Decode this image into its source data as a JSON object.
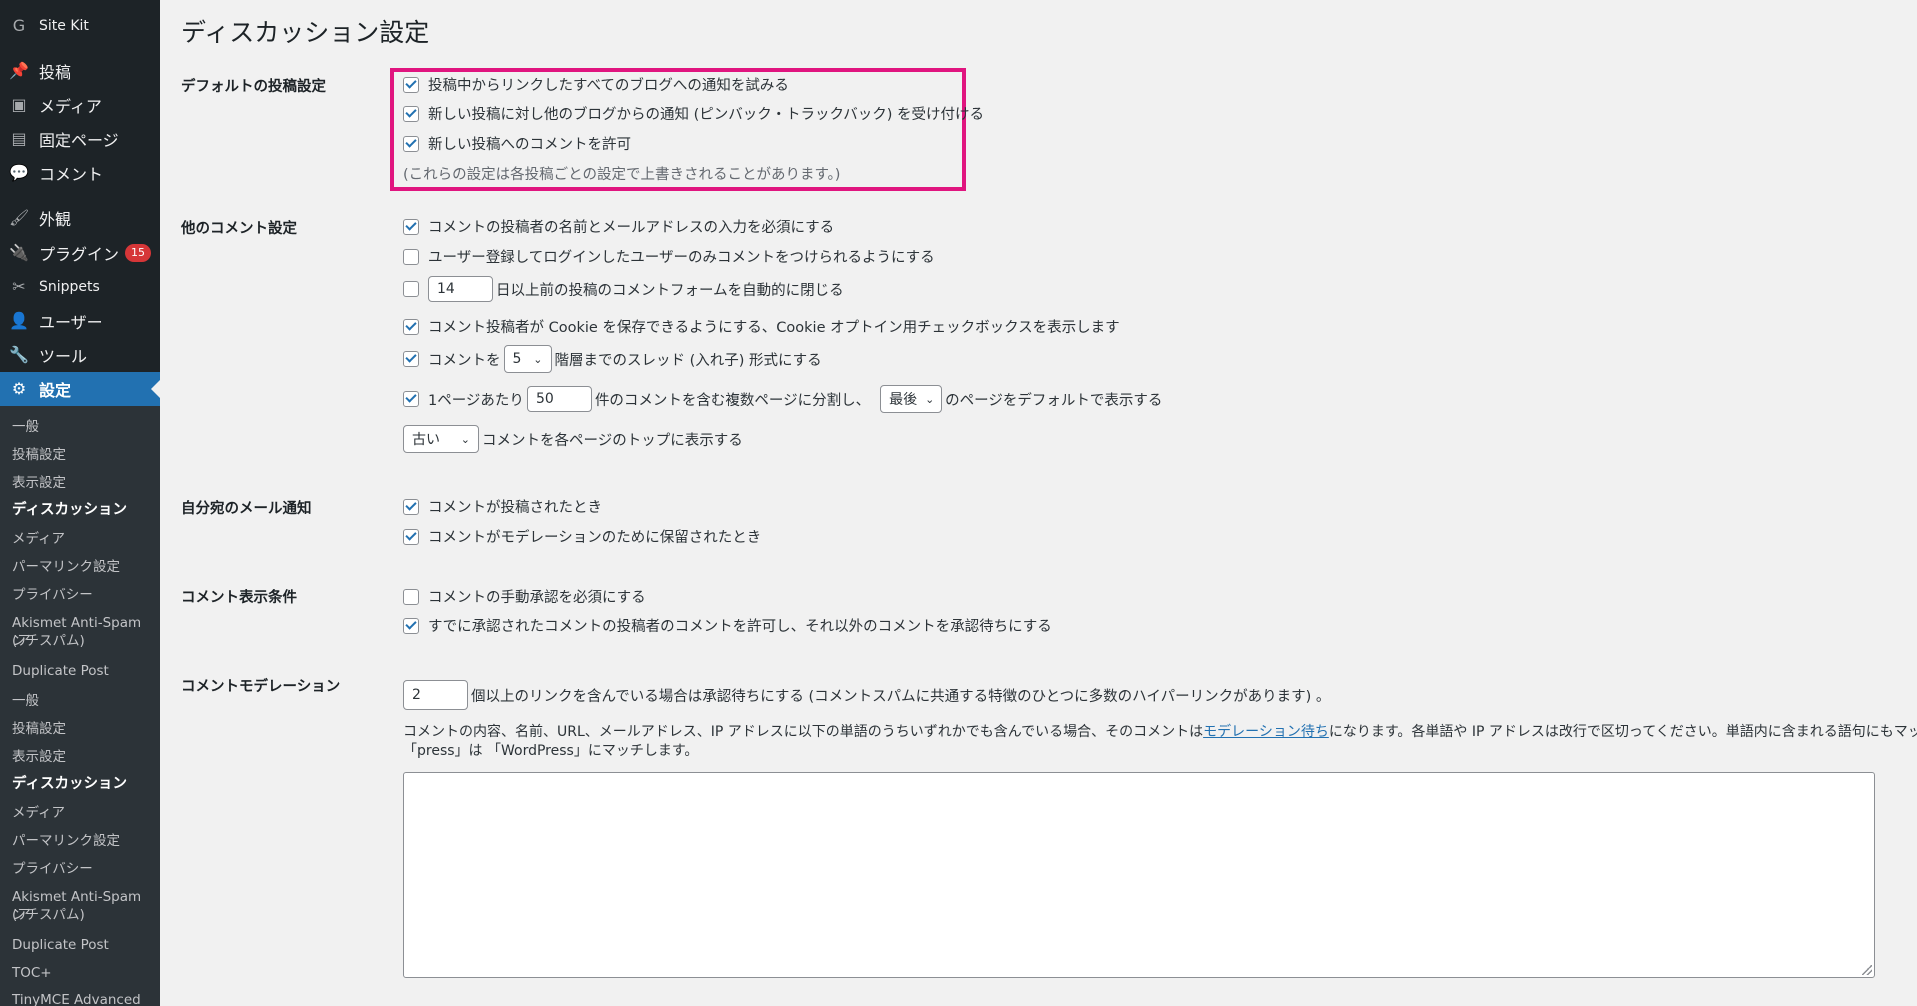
{
  "sidebar": {
    "menu": [
      {
        "icon": "G",
        "icon_name": "google-g-icon",
        "label": "Site Kit"
      },
      {
        "icon": "📌",
        "icon_name": "pin-icon",
        "label": "投稿"
      },
      {
        "icon": "▣",
        "icon_name": "media-icon",
        "label": "メディア"
      },
      {
        "icon": "▤",
        "icon_name": "page-icon",
        "label": "固定ページ"
      },
      {
        "icon": "💬",
        "icon_name": "comment-icon",
        "label": "コメント"
      },
      {
        "icon": "🖌",
        "icon_name": "brush-icon",
        "label": "外観"
      },
      {
        "icon": "🔌",
        "icon_name": "plugin-icon",
        "label": "プラグイン",
        "badge": "15"
      },
      {
        "icon": "✂",
        "icon_name": "scissors-icon",
        "label": "Snippets"
      },
      {
        "icon": "👤",
        "icon_name": "user-icon",
        "label": "ユーザー"
      },
      {
        "icon": "🔧",
        "icon_name": "wrench-icon",
        "label": "ツール"
      },
      {
        "icon": "⚙",
        "icon_name": "settings-icon",
        "label": "設定"
      }
    ],
    "submenu": [
      "一般",
      "投稿設定",
      "表示設定",
      "ディスカッション",
      "メディア",
      "パーマリンク設定",
      "プライバシー",
      "Akismet Anti-Spam (ア",
      "ンチスパム)",
      "Duplicate Post",
      "一般",
      "投稿設定",
      "表示設定",
      "ディスカッション",
      "メディア",
      "パーマリンク設定",
      "プライバシー",
      "Akismet Anti-Spam (ア",
      "ンチスパム)",
      "Duplicate Post",
      "TOC+",
      "TinyMCE Advanced"
    ]
  },
  "page": {
    "title": "ディスカッション設定"
  },
  "default_post": {
    "label": "デフォルトの投稿設定",
    "items": [
      {
        "checked": true,
        "text": "投稿中からリンクしたすべてのブログへの通知を試みる"
      },
      {
        "checked": true,
        "text": "新しい投稿に対し他のブログからの通知 (ピンバック・トラックバック) を受け付ける"
      },
      {
        "checked": true,
        "text": "新しい投稿へのコメントを許可"
      }
    ],
    "note": "(これらの設定は各投稿ごとの設定で上書きされることがあります。)"
  },
  "other_comments": {
    "label": "他のコメント設定",
    "require_name": "コメントの投稿者の名前とメールアドレスの入力を必須にする",
    "registered_only": "ユーザー登録してログインしたユーザーのみコメントをつけられるようにする",
    "close_days": "14",
    "close_text": "日以上前の投稿のコメントフォームを自動的に閉じる",
    "cookies_text": "コメント投稿者が Cookie を保存できるようにする、Cookie オプトイン用チェックボックスを表示します",
    "thread_prefix": "コメントを",
    "thread_depth": "5",
    "thread_suffix": "階層までのスレッド (入れ子) 形式にする",
    "page_prefix": "1ページあたり",
    "per_page": "50",
    "page_middle": "件のコメントを含む複数ページに分割し、",
    "default_page": "最後",
    "page_suffix": "のページをデフォルトで表示する",
    "order": "古い",
    "order_suffix": "コメントを各ページのトップに表示する"
  },
  "email_me": {
    "label": "自分宛のメール通知",
    "comment_posted": "コメントが投稿されたとき",
    "comment_moderation": "コメントがモデレーションのために保留されたとき"
  },
  "comment_appear": {
    "label": "コメント表示条件",
    "manual_approval": "コメントの手動承認を必須にする",
    "previously_approved": "すでに承認されたコメントの投稿者のコメントを許可し、それ以外のコメントを承認待ちにする"
  },
  "moderation": {
    "label": "コメントモデレーション",
    "links_count": "2",
    "links_text": "個以上のリンクを含んでいる場合は承認待ちにする (コメントスパムに共通する特徴のひとつに多数のハイパーリンクがあります) 。",
    "para_before": "コメントの内容、名前、URL、メールアドレス、IP アドレスに以下の単語のうちいずれかでも含んでいる場合、そのコメントは",
    "para_link": "モデレーション待ち",
    "para_after": "になります。各単語や IP アドレスは改行で区切ってください。単語内に含まれる語句にもマッチします。例: 「press」は 「WordPress」にマッチします。",
    "textarea_value": ""
  },
  "colors": {
    "sidebar_bg": "#1d2327",
    "active_blue": "#2271b1",
    "highlight_magenta": "#e0157f",
    "badge_red": "#d63638"
  }
}
